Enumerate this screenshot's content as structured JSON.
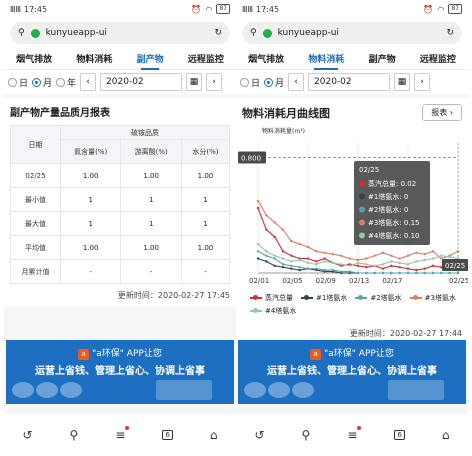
{
  "left": {
    "status": {
      "signal": "ⅢⅢ",
      "time": "17:45",
      "battery": "87"
    },
    "url": {
      "text": "kunyueapp-ui"
    },
    "tabs": [
      {
        "label": "烟气排放",
        "active": false
      },
      {
        "label": "物料消耗",
        "active": false
      },
      {
        "label": "副产物",
        "active": true
      },
      {
        "label": "远程监控",
        "active": false
      }
    ],
    "filter": {
      "day": "日",
      "month": "月",
      "year": "年",
      "date": "2020-02",
      "prev": "‹",
      "next": "›"
    },
    "report": {
      "title": "副产物产量品质月报表",
      "group_header": "硫铵品质",
      "date_header": "日期",
      "cols": [
        "氮含量(%)",
        "游离酸(%)",
        "水分(%)"
      ],
      "rows": [
        {
          "label": "02/25",
          "vals": [
            "1.00",
            "1.00",
            "1.00"
          ]
        },
        {
          "label": "最小值",
          "vals": [
            "1",
            "1",
            "1"
          ]
        },
        {
          "label": "最大值",
          "vals": [
            "1",
            "1",
            "1"
          ]
        },
        {
          "label": "平均值",
          "vals": [
            "1.00",
            "1.00",
            "1.00"
          ]
        },
        {
          "label": "月累计值",
          "vals": [
            "-",
            "-",
            "-"
          ]
        }
      ]
    },
    "updated": "更新时间：2020-02-27 17:45"
  },
  "right": {
    "status": {
      "signal": "ⅢⅢ",
      "time": "17:45",
      "battery": "87"
    },
    "url": {
      "text": "kunyueapp-ui"
    },
    "tabs": [
      {
        "label": "烟气排放",
        "active": false
      },
      {
        "label": "物料消耗",
        "active": true
      },
      {
        "label": "副产物",
        "active": false
      },
      {
        "label": "远程监控",
        "active": false
      }
    ],
    "filter": {
      "day": "日",
      "month": "月",
      "date": "2020-02",
      "prev": "‹",
      "next": "›"
    },
    "chart_title": "物料消耗月曲线图",
    "report_btn": "报表 ›",
    "updated": "更新时间：2020-02-27 17:44"
  },
  "banner": {
    "line1": "\"a环保\" APP让您",
    "line2": "运营上省钱、管理上省心、协调上省事"
  },
  "navbar": {
    "back": "↺",
    "search": "⚲",
    "menu": "≡",
    "tabs": "6",
    "home": "⌂"
  },
  "chart_data": {
    "type": "line",
    "ylabel": "物料消耗量(m³)",
    "ylim": [
      0,
      0.9
    ],
    "y_marker": "0.800",
    "categories": [
      "02/01",
      "02/02",
      "02/03",
      "02/04",
      "02/05",
      "02/06",
      "02/07",
      "02/08",
      "02/09",
      "02/10",
      "02/11",
      "02/12",
      "02/13",
      "02/14",
      "02/15",
      "02/16",
      "02/17",
      "02/18",
      "02/19",
      "02/20",
      "02/21",
      "02/22",
      "02/23",
      "02/24",
      "02/25"
    ],
    "x_tick_labels": [
      "02/01",
      "02/05",
      "02/09",
      "02/13",
      "02/17",
      "02/25"
    ],
    "series": [
      {
        "name": "蒸汽总量",
        "color": "#c23531",
        "values": [
          0.45,
          0.3,
          0.25,
          0.15,
          0.12,
          0.1,
          0.1,
          0.08,
          0.1,
          0.07,
          0.05,
          0.06,
          0.05,
          0.04,
          0.05,
          0.03,
          0.05,
          0.04,
          0.03,
          0.02,
          0.03,
          0.05,
          0.04,
          0.03,
          0.02
        ]
      },
      {
        "name": "#1塔氨水",
        "color": "#2f4554",
        "values": [
          0.1,
          0.08,
          0.05,
          0.04,
          0.03,
          0.02,
          0.03,
          0.02,
          0.01,
          0.01,
          0,
          0,
          0,
          0,
          0,
          0,
          0,
          0,
          0,
          0,
          0,
          0,
          0,
          0,
          0
        ]
      },
      {
        "name": "#2塔氨水",
        "color": "#61a0a8",
        "values": [
          0.15,
          0.12,
          0.1,
          0.06,
          0.05,
          0.04,
          0.03,
          0.03,
          0.02,
          0.02,
          0.01,
          0.01,
          0,
          0,
          0,
          0,
          0,
          0,
          0,
          0,
          0,
          0,
          0,
          0,
          0
        ]
      },
      {
        "name": "#3塔氨水",
        "color": "#d48265",
        "values": [
          0.5,
          0.4,
          0.35,
          0.3,
          0.22,
          0.2,
          0.18,
          0.15,
          0.14,
          0.13,
          0.12,
          0.1,
          0.09,
          0.1,
          0.12,
          0.14,
          0.12,
          0.1,
          0.12,
          0.14,
          0.13,
          0.15,
          0.1,
          0.12,
          0.15
        ]
      },
      {
        "name": "#4塔氨水",
        "color": "#91c7ae",
        "values": [
          0.2,
          0.15,
          0.12,
          0.1,
          0.08,
          0.09,
          0.07,
          0.06,
          0.08,
          0.07,
          0.06,
          0.05,
          0.07,
          0.06,
          0.05,
          0.06,
          0.08,
          0.07,
          0.06,
          0.08,
          0.09,
          0.1,
          0.12,
          0.11,
          0.1
        ]
      }
    ],
    "tooltip": {
      "title": "02/25",
      "rows": [
        "蒸汽总量: 0.02",
        "#1塔氨水: 0",
        "#2塔氨水: 0",
        "#3塔氨水: 0.15",
        "#4塔氨水: 0.10"
      ],
      "x_label": "02/25"
    }
  }
}
